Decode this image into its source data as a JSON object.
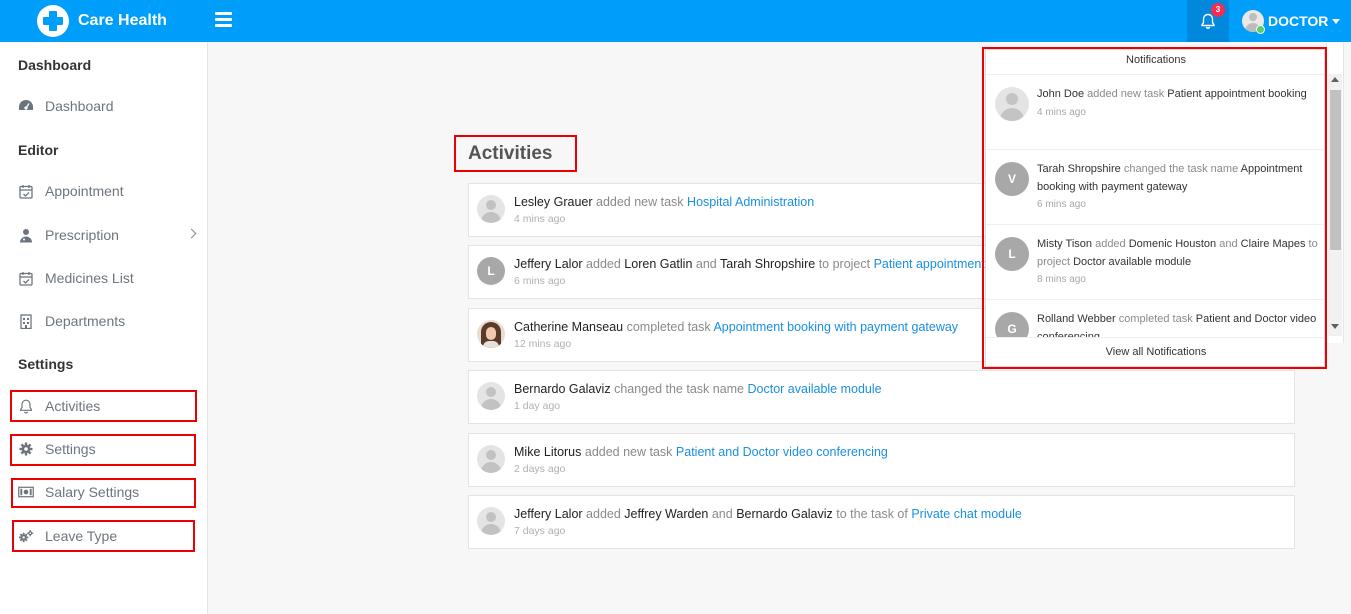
{
  "app": {
    "brand_name": "Care Health",
    "notification_count": "3",
    "user_label": "DOCTOR",
    "accent_color": "#009efb"
  },
  "sidebar": {
    "sections": [
      {
        "title": "Dashboard"
      },
      {
        "title": "Editor"
      },
      {
        "title": "Settings"
      }
    ],
    "items": [
      {
        "label": "Dashboard",
        "icon": "dashboard-icon"
      },
      {
        "label": "Appointment",
        "icon": "calendar-check-icon"
      },
      {
        "label": "Prescription",
        "icon": "user-md-icon"
      },
      {
        "label": "Medicines List",
        "icon": "calendar-check-icon"
      },
      {
        "label": "Departments",
        "icon": "hospital-icon"
      },
      {
        "label": "Activities",
        "icon": "bell-icon"
      },
      {
        "label": "Settings",
        "icon": "gear-icon"
      },
      {
        "label": "Salary Settings",
        "icon": "money-icon"
      },
      {
        "label": "Leave Type",
        "icon": "gears-icon"
      }
    ]
  },
  "main": {
    "title": "Activities",
    "activities": [
      {
        "actor": "Lesley Grauer",
        "t1": "added new task",
        "link": "Hospital Administration",
        "time": "4 mins ago"
      },
      {
        "actor": "Jeffery Lalor",
        "t1": "added",
        "p1": "Loren Gatlin",
        "t2": "and",
        "p2": "Tarah Shropshire",
        "t3": "to project",
        "link": "Patient appointment booking",
        "time": "6 mins ago",
        "letter": "L"
      },
      {
        "actor": "Catherine Manseau",
        "t1": "completed task",
        "link": "Appointment booking with payment gateway",
        "time": "12 mins ago"
      },
      {
        "actor": "Bernardo Galaviz",
        "t1": "changed the task name",
        "link": "Doctor available module",
        "time": "1 day ago"
      },
      {
        "actor": "Mike Litorus",
        "t1": "added new task",
        "link": "Patient and Doctor video conferencing",
        "time": "2 days ago"
      },
      {
        "actor": "Jeffery Lalor",
        "t1": "added",
        "p1": "Jeffrey Warden",
        "t2": "and",
        "p2": "Bernardo Galaviz",
        "t3": "to the task of",
        "link": "Private chat module",
        "time": "7 days ago"
      }
    ]
  },
  "notifications": {
    "header": "Notifications",
    "footer": "View all Notifications",
    "items": [
      {
        "actor": "John Doe",
        "t1": "added new task",
        "target": "Patient appointment booking",
        "time": "4 mins ago"
      },
      {
        "actor": "Tarah Shropshire",
        "t1": "changed the task name",
        "target": "Appointment booking with payment gateway",
        "time": "6 mins ago",
        "letter": "V"
      },
      {
        "actor": "Misty Tison",
        "t1": "added",
        "p1": "Domenic Houston",
        "t2": "and",
        "p2": "Claire Mapes",
        "t3": "to project",
        "target": "Doctor available module",
        "time": "8 mins ago",
        "letter": "L"
      },
      {
        "actor": "Rolland Webber",
        "t1": "completed task",
        "target": "Patient and Doctor video conferencing",
        "time": "",
        "letter": "G"
      }
    ]
  }
}
